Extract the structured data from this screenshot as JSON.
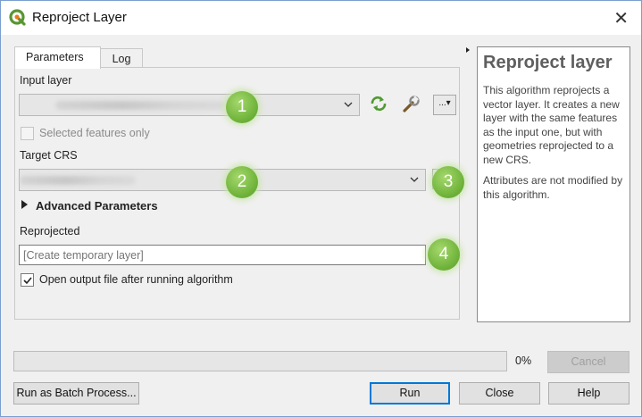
{
  "window": {
    "title": "Reproject Layer",
    "close_glyph": "✕",
    "accent": "#0078d7"
  },
  "tabs": [
    {
      "label": "Parameters",
      "active": true
    },
    {
      "label": "Log",
      "active": false
    }
  ],
  "params": {
    "input_layer_label": "Input layer",
    "selected_only_label": "Selected features only",
    "selected_only_checked": false,
    "target_crs_label": "Target CRS",
    "advanced_label": "Advanced Parameters",
    "reprojected_label": "Reprojected",
    "reprojected_placeholder": "[Create temporary layer]",
    "open_output_label": "Open output file after running algorithm",
    "open_output_checked": true,
    "dots_label": "...▾"
  },
  "badges": [
    "1",
    "2",
    "3",
    "4"
  ],
  "help": {
    "title": "Reproject layer",
    "paragraphs": [
      "This algorithm reprojects a vector layer. It creates a new layer with the same features as the input one, but with geometries reprojected to a new CRS.",
      "Attributes are not modified by this algorithm."
    ]
  },
  "footer": {
    "progress": 0,
    "progress_text": "0%",
    "cancel_label": "Cancel",
    "batch_label": "Run as Batch Process...",
    "run_label": "Run",
    "close_label": "Close",
    "help_label": "Help"
  },
  "icons": [
    "qgis-logo-icon",
    "close-icon",
    "iterate-icon",
    "wrench-icon",
    "chevron-down-icon",
    "checkmark-icon",
    "expand-triangle-icon"
  ]
}
